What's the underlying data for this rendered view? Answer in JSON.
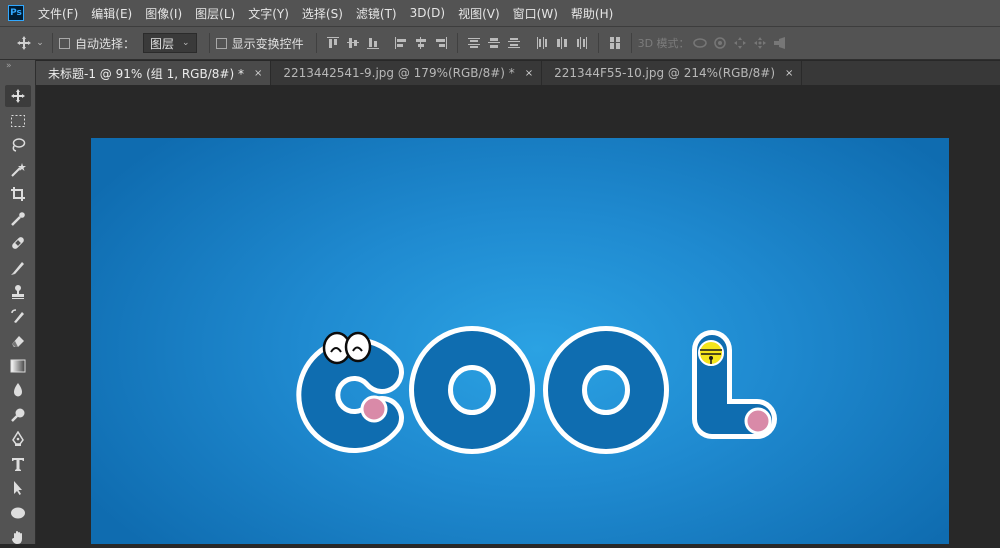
{
  "app": {
    "logo_text": "Ps"
  },
  "menu": [
    "文件(F)",
    "编辑(E)",
    "图像(I)",
    "图层(L)",
    "文字(Y)",
    "选择(S)",
    "滤镜(T)",
    "3D(D)",
    "视图(V)",
    "窗口(W)",
    "帮助(H)"
  ],
  "options": {
    "auto_select_label": "自动选择：",
    "auto_select_value": "图层",
    "show_transform_label": "显示变换控件",
    "mode_3d_label": "3D 模式："
  },
  "tabs": [
    {
      "label": "未标题-1 @ 91% (组 1, RGB/8#) *",
      "close": "×",
      "active": true
    },
    {
      "label": "2213442541-9.jpg @ 179%(RGB/8#) *",
      "close": "×",
      "active": false
    },
    {
      "label": "221344F55-10.jpg @ 214%(RGB/8#)",
      "close": "×",
      "active": false
    }
  ],
  "toolbar_grip": "»",
  "tools": [
    "move-tool",
    "marquee-tool",
    "lasso-tool",
    "magic-wand-tool",
    "crop-tool",
    "eyedropper-tool",
    "healing-brush-tool",
    "brush-tool",
    "clone-stamp-tool",
    "history-brush-tool",
    "eraser-tool",
    "gradient-tool",
    "blur-tool",
    "dodge-tool",
    "pen-tool",
    "type-tool",
    "path-selection-tool",
    "ellipse-tool",
    "hand-tool"
  ],
  "colors": {
    "canvas_blue": "#1f8ad0",
    "letter_blue": "#0f6db0",
    "cheek_pink": "#d98aa8",
    "bell_yellow": "#f4e51c",
    "ui_gray": "#535353"
  }
}
